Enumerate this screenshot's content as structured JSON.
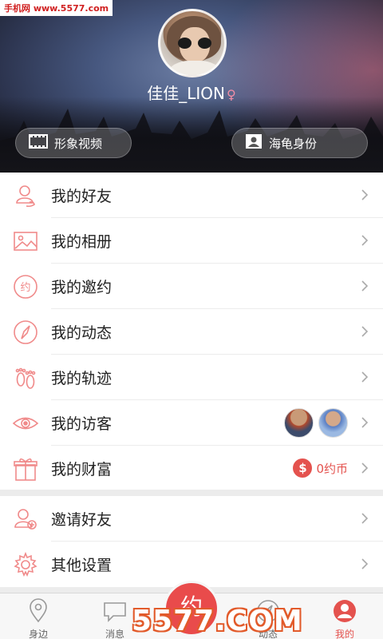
{
  "watermark_top": "手机网 www.5577.com",
  "profile": {
    "username": "佳佳_LION",
    "gender_icon": "female-symbol",
    "btn_video": "形象视频",
    "btn_identity": "海龟身份"
  },
  "menu": {
    "friends": "我的好友",
    "album": "我的相册",
    "invites": "我的邀约",
    "moments": "我的动态",
    "tracks": "我的轨迹",
    "visitors": "我的访客",
    "wealth": "我的财富",
    "wealth_value": "0约币",
    "coin_symbol": "$",
    "invite_friends": "邀请好友",
    "settings": "其他设置"
  },
  "tabs": {
    "nearby": "身边",
    "messages": "消息",
    "center": "约",
    "dynamic": "动态",
    "mine": "我的"
  },
  "watermark_bottom": "5577.COM",
  "colors": {
    "accent": "#e4524e",
    "icon": "#f08a8a"
  }
}
